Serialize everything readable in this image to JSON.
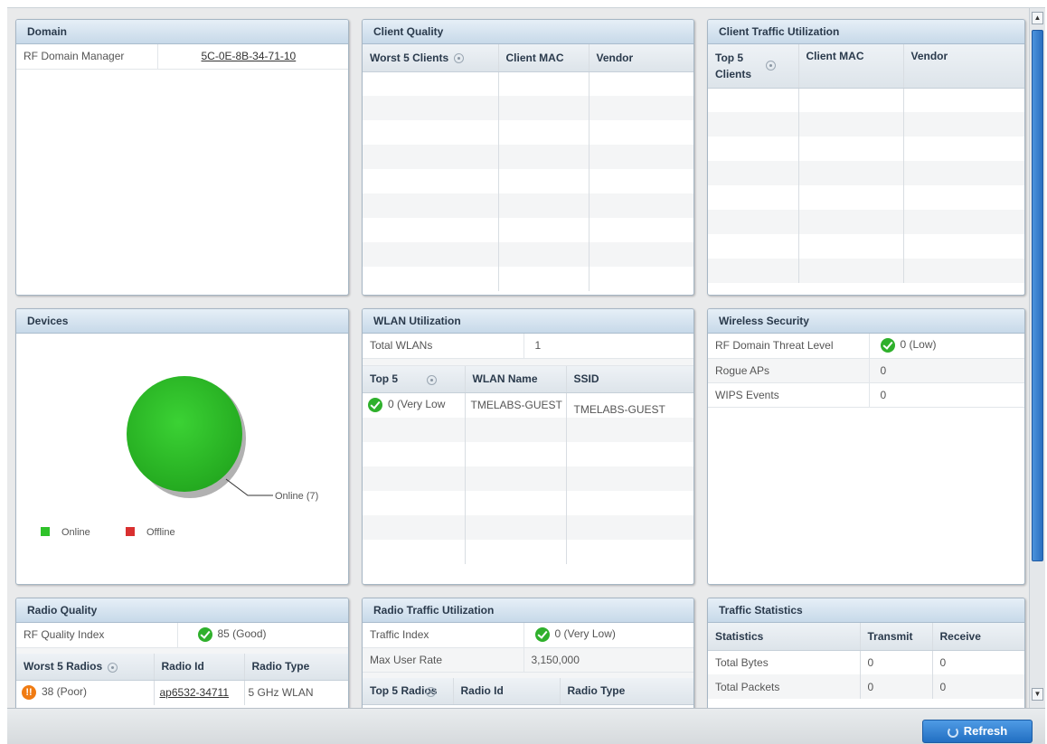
{
  "domain": {
    "title": "Domain",
    "rows": [
      {
        "label": "RF Domain Manager",
        "value": "5C-0E-8B-34-71-10"
      }
    ]
  },
  "client_quality": {
    "title": "Client Quality",
    "columns": [
      "Worst 5 Clients",
      "Client MAC",
      "Vendor"
    ]
  },
  "client_traffic": {
    "title": "Client Traffic Utilization",
    "columns": [
      "Top 5 Clients",
      "Client MAC",
      "Vendor"
    ]
  },
  "devices": {
    "title": "Devices",
    "slice_label": "Online (7)",
    "legend": [
      {
        "label": "Online",
        "color": "#2fc22a"
      },
      {
        "label": "Offline",
        "color": "#d93030"
      }
    ],
    "chart_data": {
      "type": "pie",
      "categories": [
        "Online",
        "Offline"
      ],
      "values": [
        7,
        0
      ],
      "colors": [
        "#2fc22a",
        "#d93030"
      ]
    }
  },
  "wlan": {
    "title": "WLAN Utilization",
    "total_label": "Total WLANs",
    "total_value": "1",
    "columns": [
      "Top 5",
      "WLAN Name",
      "SSID"
    ],
    "rows": [
      {
        "top": "0 (Very Low",
        "name": "TMELABS-GUEST",
        "ssid": "TMELABS-GUEST"
      }
    ]
  },
  "wireless_security": {
    "title": "Wireless Security",
    "rows": [
      {
        "label": "RF Domain Threat Level",
        "value": "0 (Low)"
      },
      {
        "label": "Rogue APs",
        "value": "0"
      },
      {
        "label": "WIPS Events",
        "value": "0"
      }
    ]
  },
  "radio_quality": {
    "title": "Radio Quality",
    "index_label": "RF Quality Index",
    "index_value": "85 (Good)",
    "columns": [
      "Worst 5 Radios",
      "Radio Id",
      "Radio Type"
    ],
    "rows": [
      {
        "radio": "38 (Poor)",
        "id": "ap6532-34711",
        "type": "5 GHz WLAN"
      }
    ]
  },
  "radio_traffic": {
    "title": "Radio Traffic Utilization",
    "rows": [
      {
        "label": "Traffic Index",
        "value": "0 (Very Low)"
      },
      {
        "label": "Max User Rate",
        "value": "3,150,000"
      }
    ],
    "columns": [
      "Top 5 Radios",
      "Radio Id",
      "Radio Type"
    ]
  },
  "traffic_stats": {
    "title": "Traffic Statistics",
    "columns": [
      "Statistics",
      "Transmit",
      "Receive"
    ],
    "rows": [
      {
        "name": "Total Bytes",
        "tx": "0",
        "rx": "0"
      },
      {
        "name": "Total Packets",
        "tx": "0",
        "rx": "0"
      }
    ]
  },
  "footer": {
    "refresh_label": "Refresh"
  },
  "colors": {
    "accent": "#2b6fc0",
    "ok": "#2fb02c",
    "warn": "#f07b12"
  }
}
